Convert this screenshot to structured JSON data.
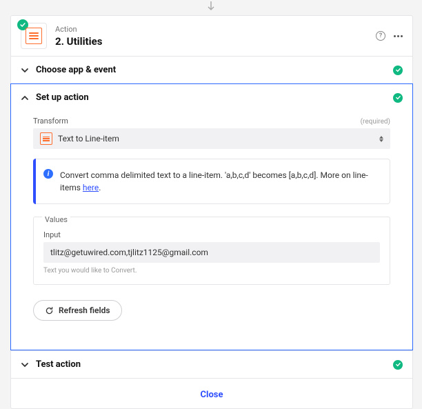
{
  "header": {
    "label": "Action",
    "title": "2. Utilities"
  },
  "sections": {
    "choose": {
      "title": "Choose app & event"
    },
    "setup": {
      "title": "Set up action",
      "transform": {
        "label": "Transform",
        "required": "(required)",
        "value": "Text to Line-item"
      },
      "info": {
        "text": "Convert comma delimited text to a line-item. 'a,b,c,d' becomes [a,b,c,d]. More on line-items ",
        "link": "here"
      },
      "values": {
        "legend": "Values",
        "input_label": "Input",
        "input_value": "tlitz@getuwired.com,tjlitz1125@gmail.com",
        "hint": "Text you would like to Convert."
      },
      "refresh": "Refresh fields"
    },
    "test": {
      "title": "Test action"
    }
  },
  "close": "Close"
}
